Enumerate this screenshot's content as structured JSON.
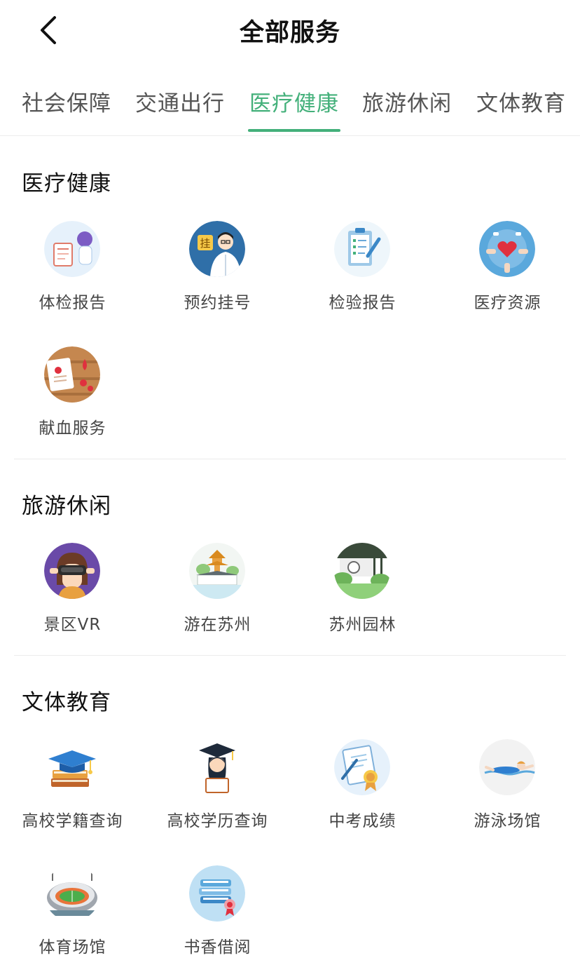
{
  "header": {
    "title": "全部服务",
    "back_icon": "chevron-left-icon"
  },
  "tabs": [
    {
      "label": "社会保障",
      "active": false
    },
    {
      "label": "交通出行",
      "active": false
    },
    {
      "label": "医疗健康",
      "active": true
    },
    {
      "label": "旅游休闲",
      "active": false
    },
    {
      "label": "文体教育",
      "active": false
    }
  ],
  "colors": {
    "accent": "#43b07a",
    "divider": "#ececec",
    "label": "#444444"
  },
  "sections": [
    {
      "title": "医疗健康",
      "items": [
        {
          "label": "体检报告",
          "icon": "medical-checkup-icon"
        },
        {
          "label": "预约挂号",
          "icon": "doctor-appointment-icon"
        },
        {
          "label": "检验报告",
          "icon": "clipboard-report-icon"
        },
        {
          "label": "医疗资源",
          "icon": "heart-hands-icon"
        },
        {
          "label": "献血服务",
          "icon": "blood-donation-icon"
        }
      ]
    },
    {
      "title": "旅游休闲",
      "items": [
        {
          "label": "景区VR",
          "icon": "vr-headset-icon"
        },
        {
          "label": "游在苏州",
          "icon": "pagoda-icon"
        },
        {
          "label": "苏州园林",
          "icon": "garden-icon"
        }
      ]
    },
    {
      "title": "文体教育",
      "items": [
        {
          "label": "高校学籍查询",
          "icon": "graduation-books-icon"
        },
        {
          "label": "高校学历查询",
          "icon": "graduate-icon"
        },
        {
          "label": "中考成绩",
          "icon": "certificate-icon"
        },
        {
          "label": "游泳场馆",
          "icon": "swimmer-icon"
        },
        {
          "label": "体育场馆",
          "icon": "stadium-icon"
        },
        {
          "label": "书香借阅",
          "icon": "books-icon"
        }
      ]
    }
  ]
}
